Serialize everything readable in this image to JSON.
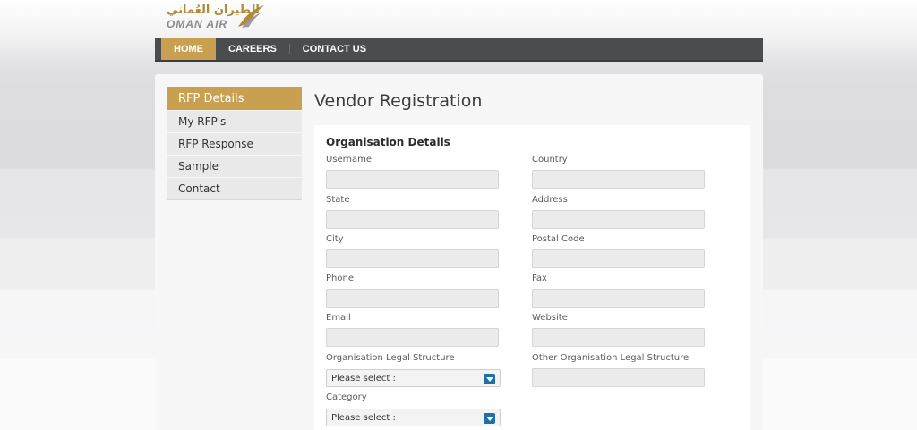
{
  "header": {
    "logo_arabic": "الطيران العُماني",
    "logo_latin": "OMAN AIR"
  },
  "nav": {
    "items": [
      {
        "label": "HOME"
      },
      {
        "label": "CAREERS"
      },
      {
        "label": "CONTACT US"
      }
    ]
  },
  "sidebar": {
    "heading": "RFP Details",
    "items": [
      {
        "label": "My RFP's"
      },
      {
        "label": "RFP Response"
      },
      {
        "label": "Sample"
      },
      {
        "label": "Contact"
      }
    ]
  },
  "main": {
    "title": "Vendor Registration",
    "section_title": "Organisation Details",
    "fields": {
      "username": {
        "label": "Username",
        "value": ""
      },
      "country": {
        "label": "Country",
        "value": ""
      },
      "state": {
        "label": "State",
        "value": ""
      },
      "address": {
        "label": "Address",
        "value": ""
      },
      "city": {
        "label": "City",
        "value": ""
      },
      "postal_code": {
        "label": "Postal Code",
        "value": ""
      },
      "phone": {
        "label": "Phone",
        "value": ""
      },
      "fax": {
        "label": "Fax",
        "value": ""
      },
      "email": {
        "label": "Email",
        "value": ""
      },
      "website": {
        "label": "Website",
        "value": ""
      },
      "legal_structure": {
        "label": "Organisation Legal Structure",
        "selected": "Please select :"
      },
      "other_legal_structure": {
        "label": "Other Organisation Legal Structure",
        "value": ""
      },
      "category": {
        "label": "Category",
        "selected": "Please select :"
      }
    }
  },
  "colors": {
    "accent": "#c8a04f",
    "nav_bg": "#4b4c4e",
    "select_arrow": "#1f6fa8"
  }
}
